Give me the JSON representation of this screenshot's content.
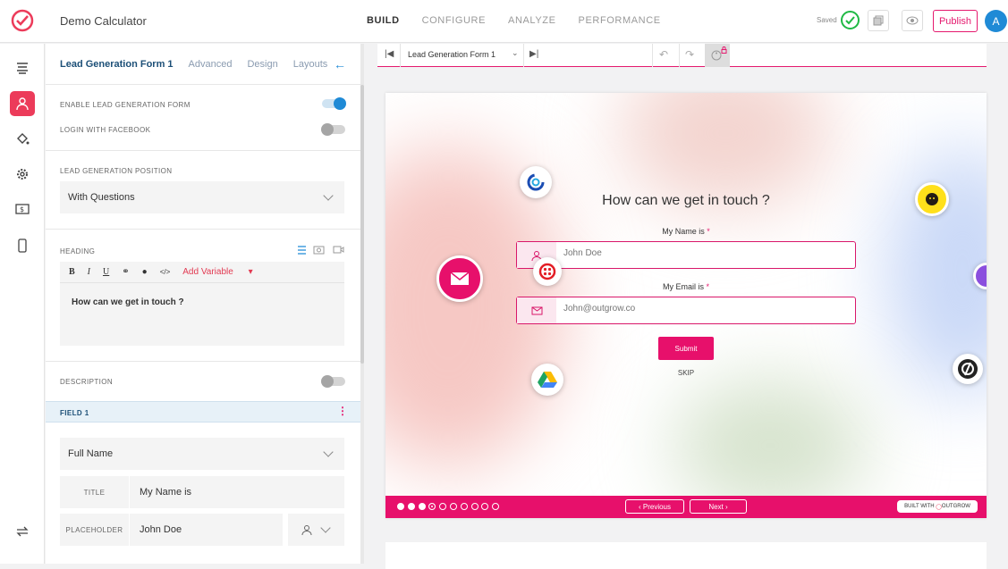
{
  "header": {
    "app_name": "Demo Calculator",
    "tabs": [
      "BUILD",
      "CONFIGURE",
      "ANALYZE",
      "PERFORMANCE"
    ],
    "active_tab": "BUILD",
    "saved_label": "Saved",
    "publish_label": "Publish",
    "avatar_letter": "A"
  },
  "panel": {
    "tabs": [
      "Lead Generation Form 1",
      "Advanced",
      "Design",
      "Layouts"
    ],
    "enable_label": "ENABLE LEAD GENERATION FORM",
    "enable_on": true,
    "facebook_label": "LOGIN WITH FACEBOOK",
    "facebook_on": false,
    "position_label": "LEAD GENERATION POSITION",
    "position_value": "With Questions",
    "heading_label": "HEADING",
    "editor_toolbar": [
      "B",
      "I",
      "U"
    ],
    "add_variable": "Add Variable",
    "heading_text": "How can we get in touch ?",
    "description_label": "DESCRIPTION",
    "description_on": false,
    "field_label": "FIELD 1",
    "field_type": "Full Name",
    "title_key": "TITLE",
    "title_value": "My Name is",
    "placeholder_key": "PLACEHOLDER",
    "placeholder_value": "John Doe"
  },
  "subbar": {
    "form_select": "Lead Generation Form 1"
  },
  "form": {
    "question": "How can we get in touch ?",
    "name_label": "My Name is",
    "name_placeholder": "John Doe",
    "email_label": "My Email is",
    "email_placeholder": "John@outgrow.co",
    "required_mark": "*",
    "submit": "Submit",
    "skip": "SKIP"
  },
  "footer": {
    "prev": "Previous",
    "next": "Next",
    "built_with": "BUILT WITH",
    "brand": "OUTGROW",
    "total_steps": 10,
    "current_step": 4
  },
  "colors": {
    "accent": "#e7106b",
    "blue": "#1f8ad6"
  }
}
